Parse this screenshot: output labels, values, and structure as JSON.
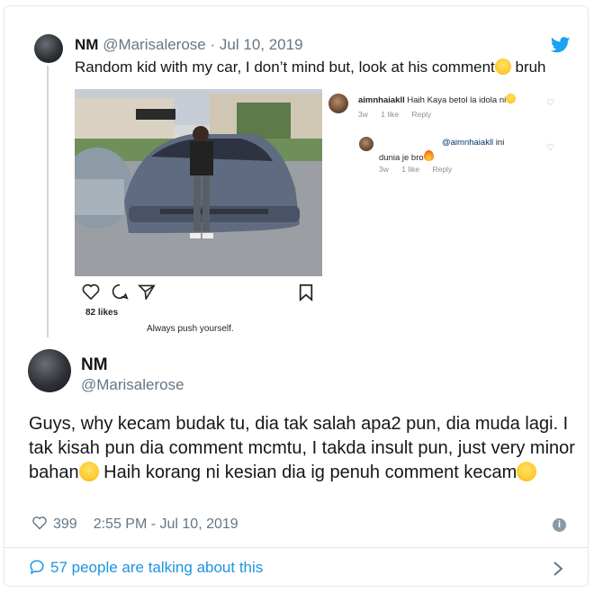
{
  "quoted_tweet": {
    "name": "NM",
    "handle": "@Marisalerose",
    "separator": "·",
    "date": "Jul 10, 2019",
    "text": "Random kid with my car, I don’t mind but, look at his comment",
    "text_suffix": " bruh",
    "emoji": "face-with-tears-of-joy"
  },
  "instagram": {
    "likes": "82 likes",
    "caption": "Always push yourself.",
    "comments": [
      {
        "user": "aimnhaiakll",
        "text": "Haih Kaya betol la idola ni",
        "emoji": "weary-face",
        "time": "3w",
        "likes": "1 like",
        "reply": "Reply"
      },
      {
        "mention": "@aimnhaiakll",
        "text_a": "ini",
        "text_b": "dunia je bro",
        "emoji": "fire",
        "time": "3w",
        "likes": "1 like",
        "reply": "Reply"
      }
    ]
  },
  "tweet": {
    "name": "NM",
    "handle": "@Marisalerose",
    "text_1": "Guys, why kecam budak tu, dia tak salah apa2 pun, dia muda lagi. I tak kisah pun dia comment mcmtu, I takda insult pun, just very minor bahan",
    "text_2": " Haih korang ni kesian dia ig penuh comment kecam",
    "emoji_1": "face-with-tears-of-joy",
    "emoji_2": "pensive-face",
    "likes": "399",
    "time": "2:55 PM - Jul 10, 2019"
  },
  "footer": {
    "talking": "57 people are talking about this"
  },
  "colors": {
    "twitter_blue": "#1da1f2",
    "link_blue": "#1b95e0",
    "muted": "#657786",
    "border": "#e1e8ed"
  }
}
